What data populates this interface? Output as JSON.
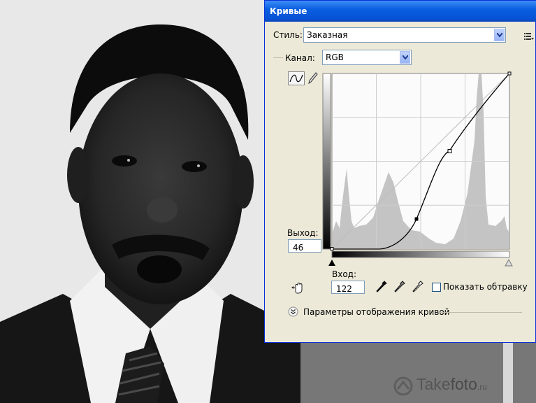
{
  "dialog": {
    "title": "Кривые",
    "style_label": "Стиль:",
    "style_value": "Заказная",
    "channel_label": "Канал:",
    "channel_value": "RGB",
    "output_label": "Выход:",
    "output_value": "46",
    "input_label": "Вход:",
    "input_value": "122",
    "show_clipping_label": "Показать обтравку",
    "show_clipping_checked": false,
    "curve_options_label": "Параметры отображения кривой"
  },
  "watermark": {
    "part1": "Take",
    "part2": "foto",
    "part3": ".ru"
  },
  "colors": {
    "titlebar": "#0a5fe0",
    "dialog_bg": "#ece9d8",
    "histogram": "#c4c4c4"
  }
}
